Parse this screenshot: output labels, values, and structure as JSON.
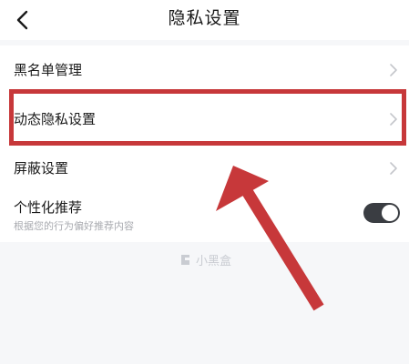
{
  "header": {
    "title": "隐私设置",
    "back_icon": "chevron-left-icon"
  },
  "list": {
    "items": [
      {
        "label": "黑名单管理",
        "icon": "chevron-right-icon"
      },
      {
        "label": "动态隐私设置",
        "icon": "chevron-right-icon"
      },
      {
        "label": "屏蔽设置",
        "icon": "chevron-right-icon"
      },
      {
        "label": "个性化推荐",
        "sublabel": "根据您的行为偏好推荐内容",
        "toggle_on": true
      }
    ]
  },
  "watermark": {
    "text": "小黑盒"
  },
  "colors": {
    "annotation": "#c7383a",
    "toggle_on": "#3a3d42",
    "background": "#f6f7f9"
  }
}
